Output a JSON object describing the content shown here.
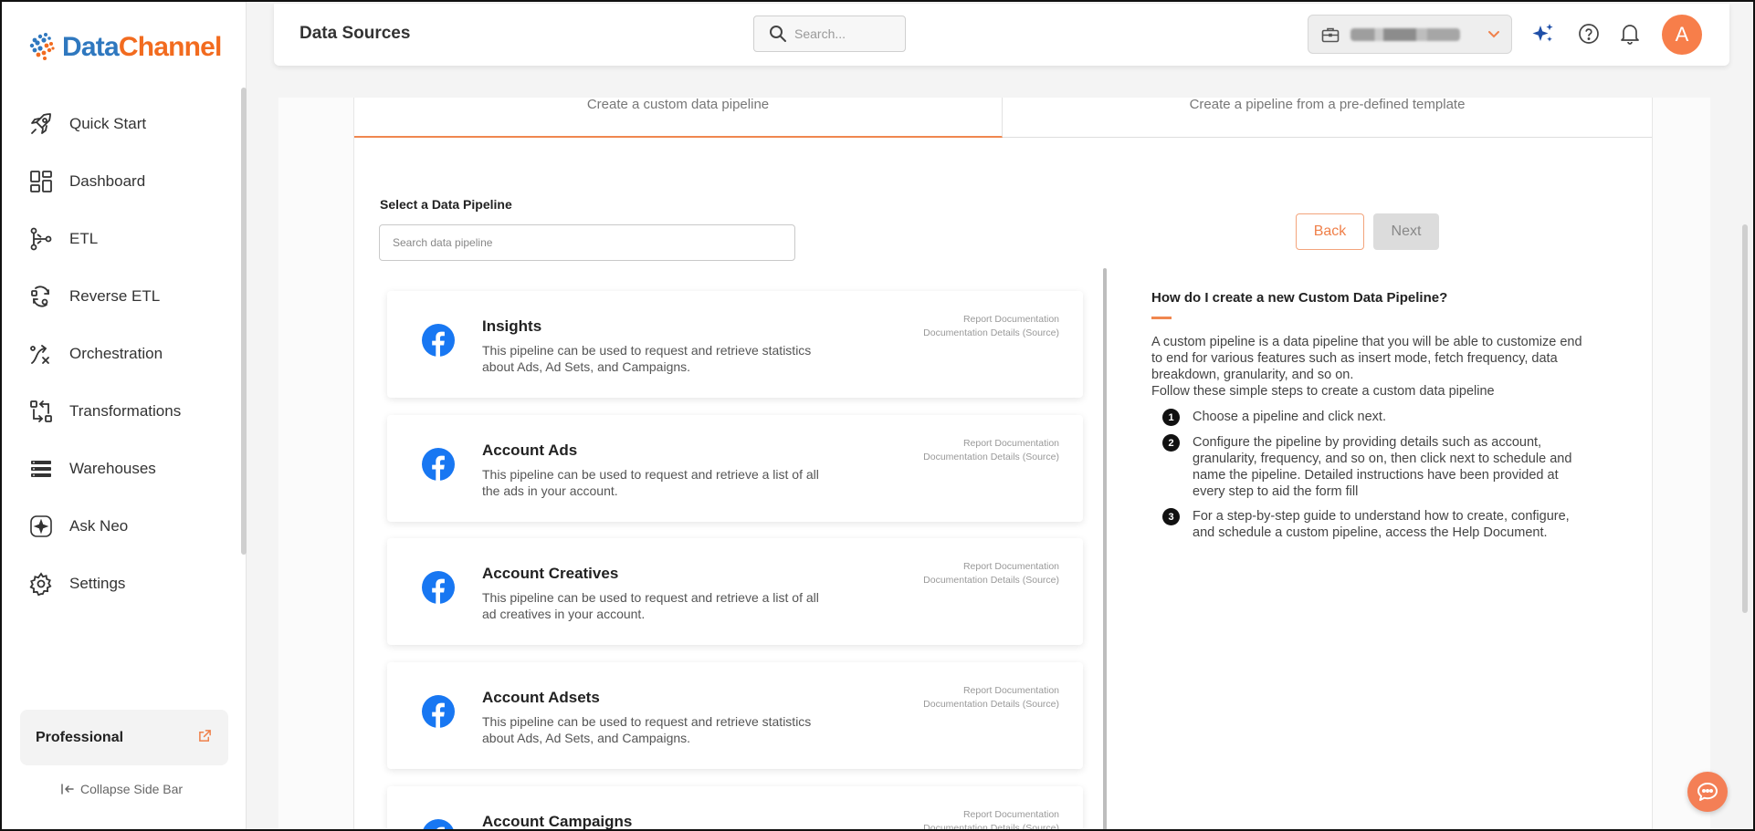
{
  "brand": {
    "data": "Data",
    "channel": "Channel"
  },
  "sidebar": {
    "items": [
      {
        "label": "Quick Start",
        "icon": "rocket-icon"
      },
      {
        "label": "Dashboard",
        "icon": "dashboard-icon"
      },
      {
        "label": "ETL",
        "icon": "etl-icon"
      },
      {
        "label": "Reverse ETL",
        "icon": "reverse-etl-icon"
      },
      {
        "label": "Orchestration",
        "icon": "orchestration-icon"
      },
      {
        "label": "Transformations",
        "icon": "transformations-icon"
      },
      {
        "label": "Warehouses",
        "icon": "warehouses-icon"
      },
      {
        "label": "Ask Neo",
        "icon": "sparkle-icon"
      },
      {
        "label": "Settings",
        "icon": "gear-icon"
      }
    ],
    "plan": "Professional",
    "collapse_label": "Collapse Side Bar"
  },
  "header": {
    "title": "Data Sources",
    "search_placeholder": "Search...",
    "avatar_letter": "A"
  },
  "tabs": [
    {
      "label": "Create a custom data pipeline",
      "active": true
    },
    {
      "label": "Create a pipeline from a pre-defined template",
      "active": false
    }
  ],
  "selector": {
    "label": "Select a Data Pipeline",
    "search_placeholder": "Search data pipeline",
    "back_label": "Back",
    "next_label": "Next"
  },
  "pipelines": [
    {
      "title": "Insights",
      "desc": "This pipeline can be used to request and retrieve statistics about Ads, Ad Sets, and Campaigns.",
      "link1": "Report Documentation",
      "link2": "Documentation Details (Source)"
    },
    {
      "title": "Account Ads",
      "desc": "This pipeline can be used to request and retrieve a list of all the ads in your account.",
      "link1": "Report Documentation",
      "link2": "Documentation Details (Source)"
    },
    {
      "title": "Account Creatives",
      "desc": "This pipeline can be used to request and retrieve a list of all ad creatives in your account.",
      "link1": "Report Documentation",
      "link2": "Documentation Details (Source)"
    },
    {
      "title": "Account Adsets",
      "desc": "This pipeline can be used to request and retrieve statistics about Ads, Ad Sets, and Campaigns.",
      "link1": "Report Documentation",
      "link2": "Documentation Details (Source)"
    },
    {
      "title": "Account Campaigns",
      "desc": "",
      "link1": "Report Documentation",
      "link2": "Documentation Details (Source)"
    }
  ],
  "help": {
    "question": "How do I create a new Custom Data Pipeline?",
    "intro": "A custom pipeline is a data pipeline that you will be able to customize end to end for various features such as insert mode, fetch frequency, data breakdown, granularity, and so on.",
    "follow": "Follow these simple steps to create a custom data pipeline",
    "steps": [
      {
        "num": "1",
        "text": "Choose a pipeline and click next."
      },
      {
        "num": "2",
        "text": "Configure the pipeline by providing details such as account, granularity, frequency, and so on, then click next to schedule and name the pipeline. Detailed instructions have been provided at every step to aid the form fill"
      },
      {
        "num": "3",
        "text": "For a step-by-step guide to understand how to create, configure, and schedule a custom pipeline, access the Help Document."
      }
    ]
  },
  "colors": {
    "accent": "#f0874f",
    "brand_blue": "#2f78bf",
    "facebook": "#1877f2"
  }
}
